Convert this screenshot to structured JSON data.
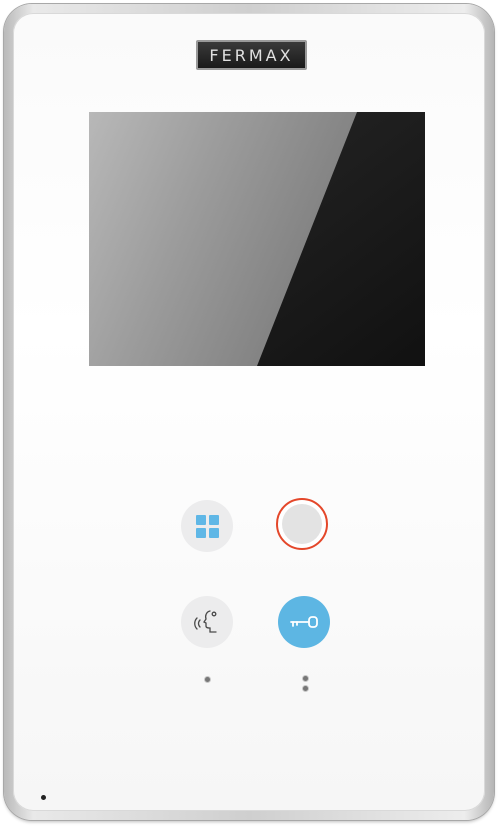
{
  "device": {
    "brand_label": "FERMAX",
    "accent_color": "#e4472a",
    "door_button_color": "#5db6e3",
    "menu_icon_color": "#5fb7e6"
  },
  "buttons": [
    {
      "name": "menu-button",
      "icon": "grid-icon"
    },
    {
      "name": "power-button",
      "icon": "ring-icon"
    },
    {
      "name": "talk-button",
      "icon": "speaking-head-icon"
    },
    {
      "name": "door-open-button",
      "icon": "key-icon"
    }
  ]
}
